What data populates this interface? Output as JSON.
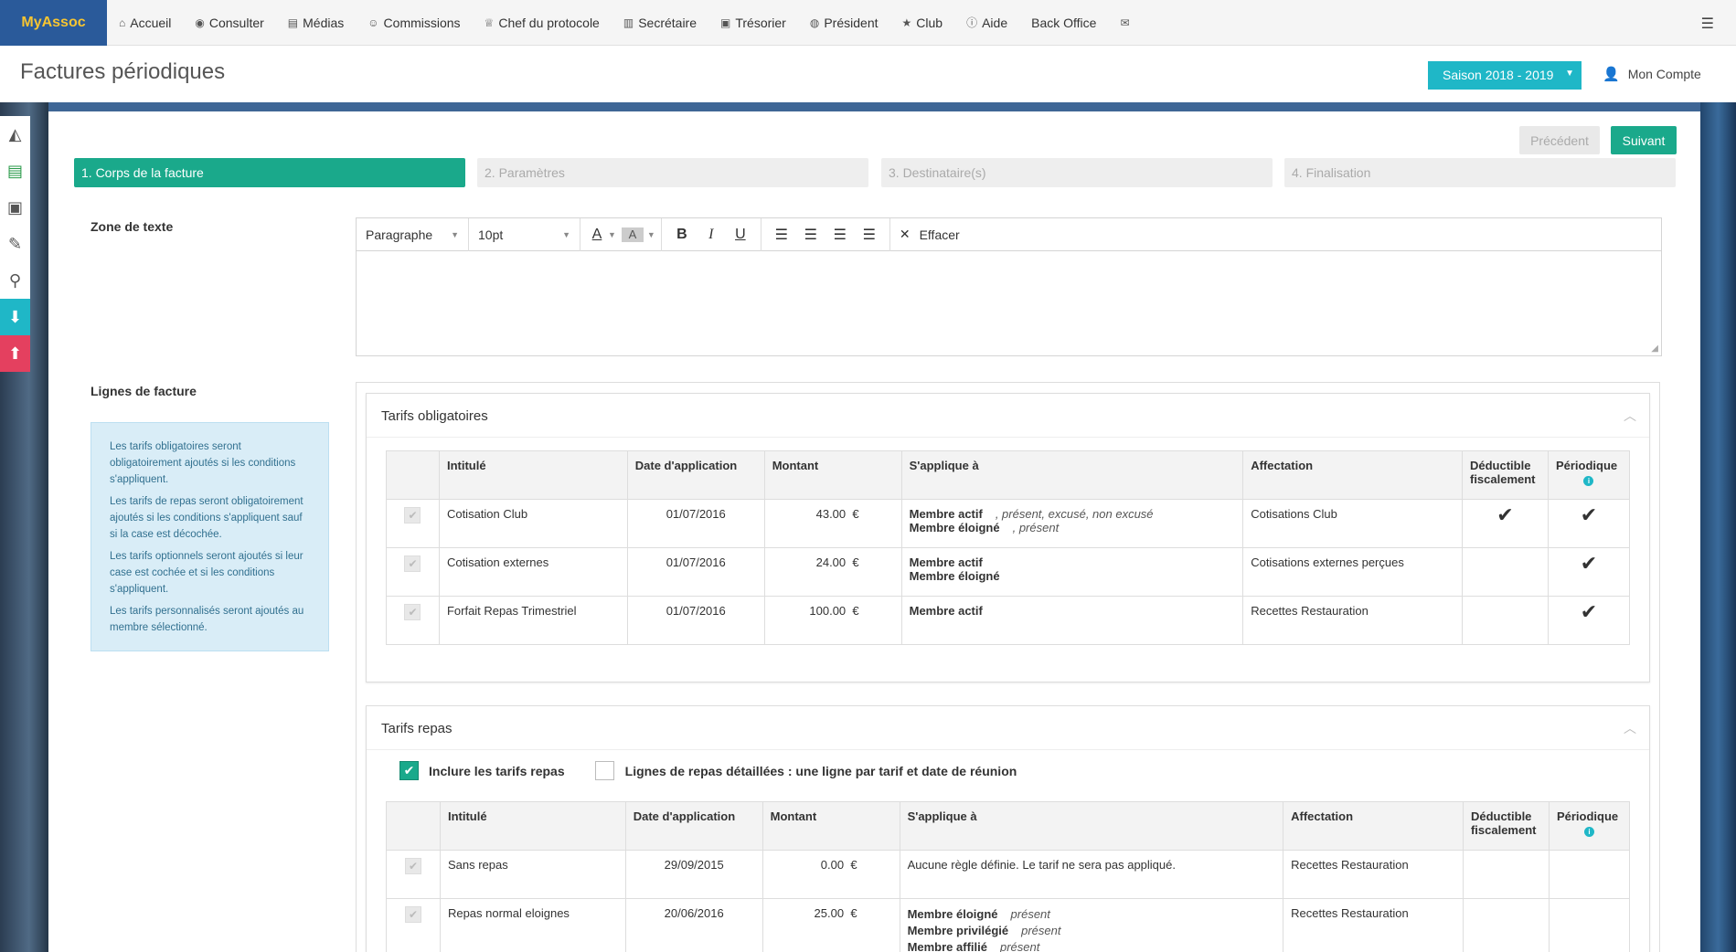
{
  "nav": {
    "brand": "MyAssoc",
    "items": [
      {
        "icon": "home-icon",
        "glyph": "⌂",
        "label": "Accueil"
      },
      {
        "icon": "eye-icon",
        "glyph": "◉",
        "label": "Consulter"
      },
      {
        "icon": "file-icon",
        "glyph": "▤",
        "label": "Médias"
      },
      {
        "icon": "user-circle-icon",
        "glyph": "☺",
        "label": "Commissions"
      },
      {
        "icon": "trophy-icon",
        "glyph": "♕",
        "label": "Chef du protocole"
      },
      {
        "icon": "book-icon",
        "glyph": "▥",
        "label": "Secrétaire"
      },
      {
        "icon": "money-icon",
        "glyph": "▣",
        "label": "Trésorier"
      },
      {
        "icon": "globe-icon",
        "glyph": "◍",
        "label": "Président"
      },
      {
        "icon": "star-icon",
        "glyph": "★",
        "label": "Club"
      },
      {
        "icon": "info-icon",
        "glyph": "ⓘ",
        "label": "Aide"
      },
      {
        "icon": "",
        "glyph": "",
        "label": "Back Office"
      },
      {
        "icon": "envelope-icon",
        "glyph": "✉",
        "label": ""
      }
    ],
    "menu_icon": "☰"
  },
  "header": {
    "title": "Factures périodiques",
    "season": "Saison 2018 - 2019",
    "account": "Mon Compte"
  },
  "wizard": {
    "prev": "Précédent",
    "next": "Suivant",
    "steps": [
      "1. Corps de la facture",
      "2. Paramètres",
      "3. Destinataire(s)",
      "4. Finalisation"
    ]
  },
  "editor": {
    "label": "Zone de texte",
    "format": "Paragraphe",
    "size": "10pt",
    "clear": "Effacer"
  },
  "lines": {
    "label": "Lignes de facture",
    "info": [
      "Les tarifs obligatoires seront obligatoirement ajoutés si les conditions s'appliquent.",
      "Les tarifs de repas seront obligatoirement ajoutés si les conditions s'appliquent sauf si la case est décochée.",
      "Les tarifs optionnels seront ajoutés si leur case est cochée et si les conditions s'appliquent.",
      "Les tarifs personnalisés seront ajoutés au membre sélectionné."
    ]
  },
  "columns": {
    "intitule": "Intitulé",
    "date": "Date d'application",
    "montant": "Montant",
    "applique": "S'applique à",
    "affectation": "Affectation",
    "deductible": "Déductible fiscalement",
    "periodique": "Périodique"
  },
  "obligatoires": {
    "title": "Tarifs obligatoires",
    "rows": [
      {
        "intitule": "Cotisation Club",
        "date": "01/07/2016",
        "montant": "43.00",
        "cur": "€",
        "a1": "Membre actif",
        "a1s": ", présent, excusé, non excusé",
        "a2": "Membre éloigné",
        "a2s": ", présent",
        "affectation": "Cotisations Club",
        "deductible": "✔",
        "periodique": "✔"
      },
      {
        "intitule": "Cotisation externes",
        "date": "01/07/2016",
        "montant": "24.00",
        "cur": "€",
        "a1": "Membre actif",
        "a1s": "",
        "a2": "Membre éloigné",
        "a2s": "",
        "affectation": "Cotisations externes perçues",
        "deductible": "",
        "periodique": "✔"
      },
      {
        "intitule": "Forfait Repas Trimestriel",
        "date": "01/07/2016",
        "montant": "100.00",
        "cur": "€",
        "a1": "Membre actif",
        "a1s": "",
        "a2": "",
        "a2s": "",
        "affectation": "Recettes Restauration",
        "deductible": "",
        "periodique": "✔"
      }
    ]
  },
  "repas": {
    "title": "Tarifs repas",
    "include": "Inclure les tarifs repas",
    "detail": "Lignes de repas détaillées : une ligne par tarif et date de réunion",
    "rows": [
      {
        "intitule": "Sans repas",
        "date": "29/09/2015",
        "montant": "0.00",
        "cur": "€",
        "plain": "Aucune règle définie. Le tarif ne sera pas appliqué.",
        "affectation": "Recettes Restauration"
      },
      {
        "intitule": "Repas normal eloignes",
        "date": "20/06/2016",
        "montant": "25.00",
        "cur": "€",
        "a1": "Membre éloigné",
        "a1s": "présent",
        "a2": "Membre privilégié",
        "a2s": "présent",
        "a3": "Membre affilié",
        "a3s": "présent",
        "affectation": "Recettes Restauration"
      }
    ]
  },
  "colors": {
    "teal": "#1aa98b",
    "cyan": "#1fb7c7",
    "brand": "#2a5a9a",
    "brandText": "#f7c531"
  }
}
